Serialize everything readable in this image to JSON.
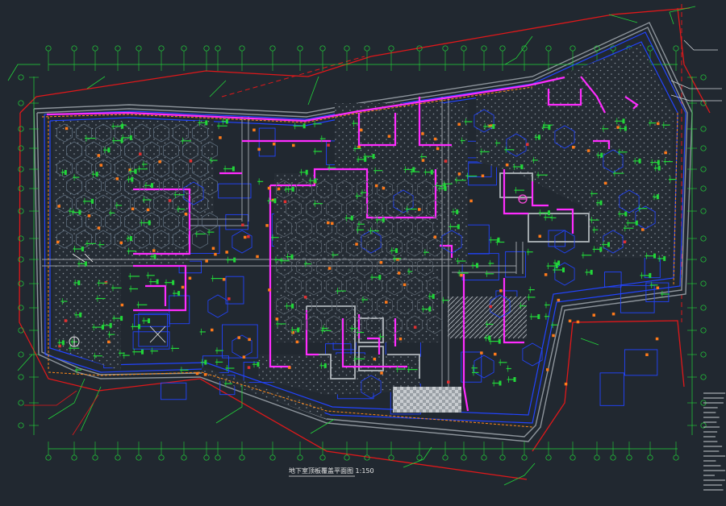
{
  "drawing": {
    "title": "地下室顶板覆盖平面图 1:150",
    "palette": {
      "background": "#212830",
      "axis": "#22d63a",
      "slab": "#2244ff",
      "wall": "#ff2cff",
      "redline": "#e0181a",
      "column": "#ff7a1a",
      "hatch": "#6f7880",
      "text": "#e8e8e8",
      "gray": "#9aa0a6"
    },
    "icons": [
      "north-arrow-icon",
      "grid-bubble-icon",
      "leader-tag-icon"
    ]
  }
}
